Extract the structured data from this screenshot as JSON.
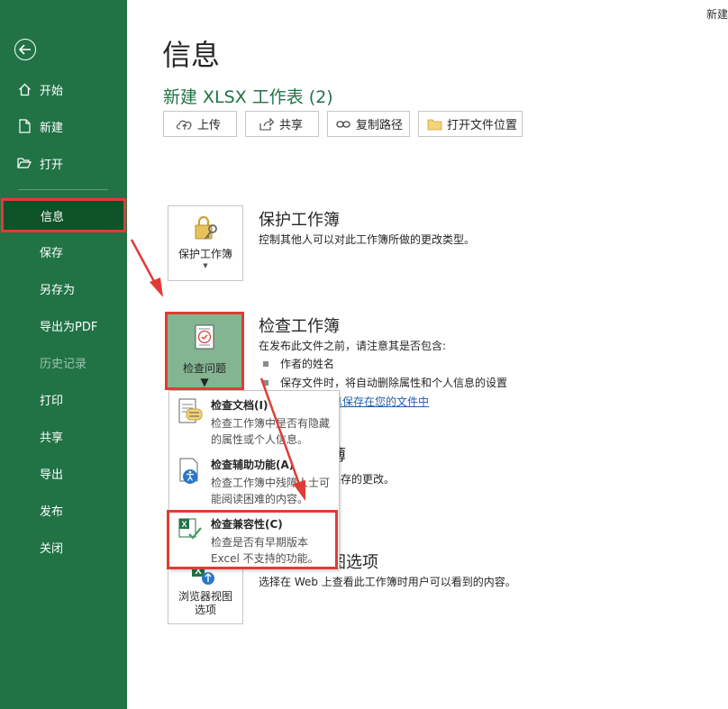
{
  "corner_text": "新建",
  "sidebar": {
    "items": [
      {
        "label": "开始",
        "icon": "home-icon"
      },
      {
        "label": "新建",
        "icon": "new-document-icon"
      },
      {
        "label": "打开",
        "icon": "open-folder-icon"
      },
      {
        "label": "信息",
        "selected": true
      },
      {
        "label": "保存"
      },
      {
        "label": "另存为"
      },
      {
        "label": "导出为PDF"
      },
      {
        "label": "历史记录",
        "disabled": true
      },
      {
        "label": "打印"
      },
      {
        "label": "共享"
      },
      {
        "label": "导出"
      },
      {
        "label": "发布"
      },
      {
        "label": "关闭"
      }
    ]
  },
  "main": {
    "title": "信息",
    "document_name": "新建 XLSX 工作表 (2)",
    "toolbar": {
      "upload": "上传",
      "share": "共享",
      "copy_path": "复制路径",
      "open_location": "打开文件位置"
    },
    "protect": {
      "button": "保护工作簿",
      "title": "保护工作簿",
      "desc": "控制其他人可以对此工作簿所做的更改类型。"
    },
    "inspect": {
      "button": "检查问题",
      "title": "检查工作簿",
      "desc": "在发布此文件之前，请注意其是否包含:",
      "bullets": [
        "作者的姓名",
        "保存文件时，将自动删除属性和个人信息的设置"
      ],
      "link_fragment": "息保存在您的文件中"
    },
    "versions": {
      "title_fragment": "簿",
      "desc_fragment": "保存的更改。"
    },
    "browser": {
      "button_line1": "浏览器视图",
      "button_line2": "选项",
      "title_fragment": "图选项",
      "desc": "选择在 Web 上查看此工作簿时用户可以看到的内容。"
    },
    "dropdown": [
      {
        "title": "检查文档(I)",
        "desc": "检查工作簿中是否有隐藏的属性或个人信息。"
      },
      {
        "title": "检查辅助功能(A)",
        "desc": "检查工作簿中残障人士可能阅读困难的内容。"
      },
      {
        "title": "检查兼容性(C)",
        "desc": "检查是否有早期版本 Excel 不支持的功能。"
      }
    ]
  },
  "colors": {
    "sidebar": "#217346",
    "selected": "#0e5228",
    "highlight": "#e03c35",
    "accent_text": "#217346"
  }
}
